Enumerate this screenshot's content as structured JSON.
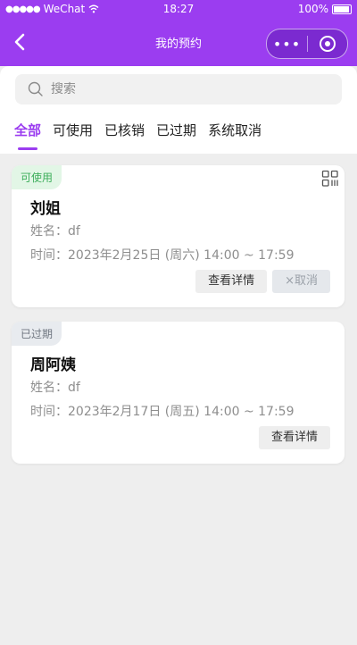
{
  "status_bar": {
    "carrier": "WeChat",
    "time": "18:27",
    "battery": "100%"
  },
  "nav": {
    "title": "我的预约",
    "more_glyph": "•••"
  },
  "search": {
    "placeholder": "搜索"
  },
  "tabs": [
    {
      "label": "全部",
      "active": true
    },
    {
      "label": "可使用"
    },
    {
      "label": "已核销"
    },
    {
      "label": "已过期"
    },
    {
      "label": "系统取消"
    }
  ],
  "colors": {
    "accent": "#9b3df0",
    "status_usable": "#3dae5b",
    "status_expired": "#6f7680"
  },
  "appointments": [
    {
      "status": "可使用",
      "name": "刘姐",
      "customer_line": "姓名：df",
      "time_line": "时间：2023年2月25日 (周六) 14:00 ~ 17:59",
      "detail_label": "查看详情",
      "cancel_label": "×取消"
    },
    {
      "status": "已过期",
      "name": "周阿姨",
      "customer_line": "姓名：df",
      "time_line": "时间：2023年2月17日 (周五) 14:00 ~ 17:59",
      "detail_label": "查看详情"
    }
  ]
}
